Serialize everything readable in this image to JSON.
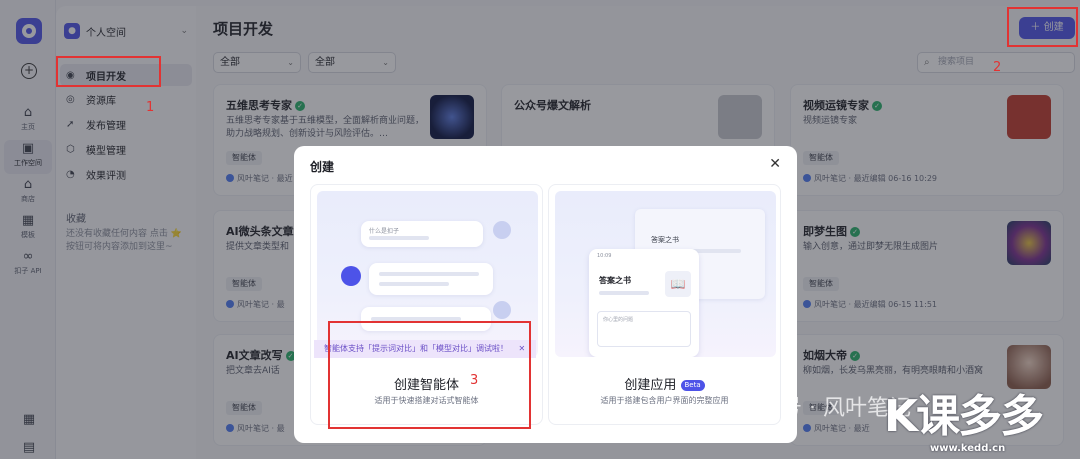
{
  "rail": {
    "items": [
      {
        "label": "主页",
        "icon": "home-icon"
      },
      {
        "label": "工作空间",
        "icon": "workspace-icon"
      },
      {
        "label": "商店",
        "icon": "store-icon"
      },
      {
        "label": "模板",
        "icon": "template-icon"
      },
      {
        "label": "扣子 API",
        "icon": "api-icon"
      }
    ]
  },
  "side": {
    "space_label": "个人空间",
    "menu": [
      {
        "label": "项目开发",
        "icon": "robot-icon"
      },
      {
        "label": "资源库",
        "icon": "library-icon"
      },
      {
        "label": "发布管理",
        "icon": "rocket-icon"
      },
      {
        "label": "模型管理",
        "icon": "model-icon"
      },
      {
        "label": "效果评测",
        "icon": "evaluate-icon"
      }
    ],
    "fav_title": "收藏",
    "fav_desc": "还没有收藏任何内容 点击 ⭐ 按钮可将内容添加到这里~"
  },
  "main": {
    "title": "项目开发",
    "create_label": "创建",
    "filter1": "全部",
    "filter2": "全部",
    "search_placeholder": "搜索项目"
  },
  "cards": [
    {
      "title": "五维思考专家",
      "verified": true,
      "desc": "五维思考专家基于五维模型，全面解析商业问题，助力战略规划、创新设计与风险评估。…",
      "tag": "智能体",
      "meta": "风叶笔记 · 最近",
      "thumb": "#0b1440"
    },
    {
      "title": "公众号爆文解析",
      "verified": false,
      "desc": "",
      "tag": "",
      "meta": "",
      "thumb": "#c7c9cf"
    },
    {
      "title": "视频运镜专家",
      "verified": true,
      "desc": "视频运镜专家",
      "tag": "智能体",
      "meta": "风叶笔记 · 最近编辑 06-16 10:29",
      "thumb": "#c0392b"
    },
    {
      "title": "AI微头条文章",
      "verified": false,
      "desc": "提供文章类型和",
      "tag": "智能体",
      "meta": "风叶笔记 · 最",
      "thumb": ""
    },
    {
      "title": "即梦生图",
      "verified": true,
      "desc": "输入创意，通过即梦无限生成图片",
      "tag": "智能体",
      "meta": "风叶笔记 · 最近编辑 06-15 11:51",
      "thumb": "#7a2d8f"
    },
    {
      "title": "AI文章改写",
      "verified": true,
      "desc": "把文章去AI话",
      "tag": "智能体",
      "meta": "风叶笔记 · 最",
      "thumb": ""
    },
    {
      "title": "如烟大帝",
      "verified": true,
      "desc": "柳如烟，长发乌黑亮丽，有明亮眼睛和小酒窝",
      "tag": "智能体",
      "meta": "风叶笔记 · 最近",
      "thumb": "#d8b8a8"
    }
  ],
  "modal": {
    "title": "创建",
    "option1": {
      "name": "创建智能体",
      "sub": "适用于快速搭建对话式智能体",
      "tip": "智能体支持「提示词对比」和「模型对比」调试啦！",
      "bubble_text": "什么是扣子"
    },
    "option2": {
      "name": "创建应用",
      "badge": "Beta",
      "sub": "适用于搭建包含用户界面的完整应用",
      "book_title": "答案之书",
      "book_title2": "答案之书",
      "input_text": "你心里的问题",
      "time": "10:09"
    }
  },
  "annotations": {
    "a1": "1",
    "a2": "2",
    "a3": "3"
  },
  "watermark": {
    "text": "公众号 · 风叶笔记",
    "brand": "课多多",
    "url": "www.kedd.cn"
  }
}
